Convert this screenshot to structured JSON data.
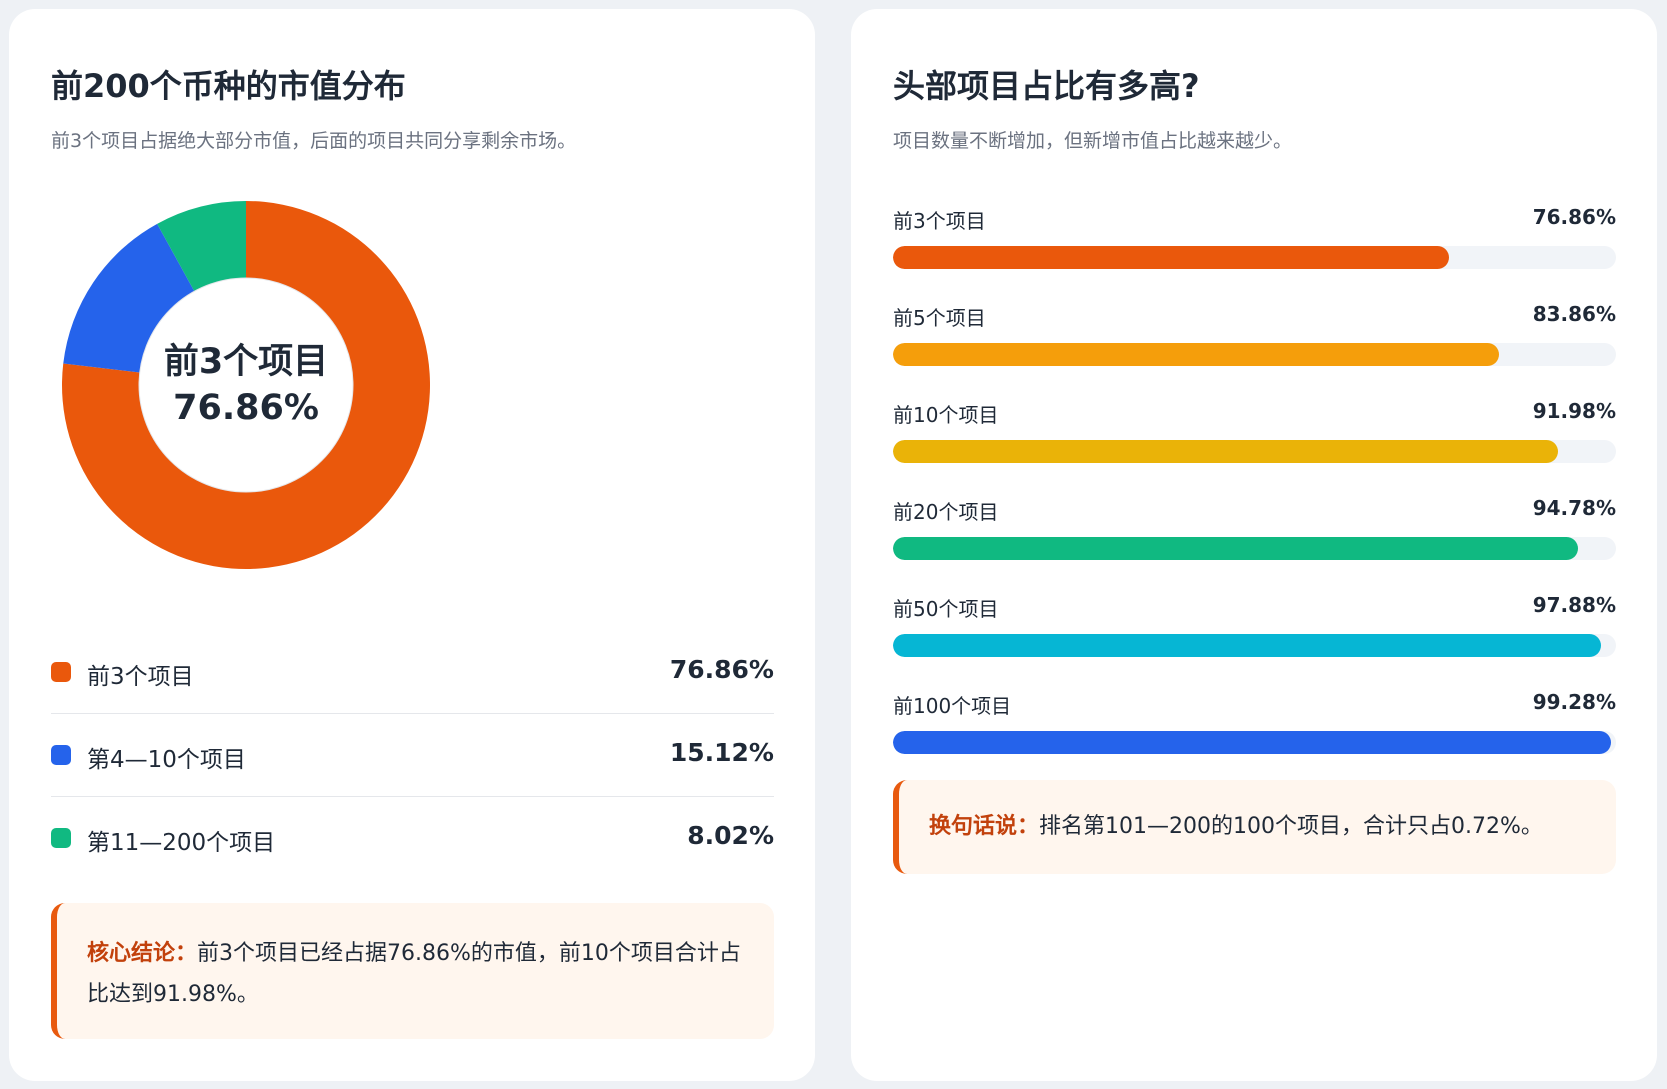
{
  "left": {
    "title": "前200个币种的市值分布",
    "subtitle": "前3个项目占据绝大部分市值，后面的项目共同分享剩余市场。",
    "center_line1": "前3个项目",
    "center_line2": "76.86%",
    "note_key": "核心结论：",
    "note_text": "前3个项目已经占据76.86%的市值，前10个项目合计占比达到91.98%。"
  },
  "right": {
    "title": "头部项目占比有多高?",
    "subtitle": "项目数量不断增加，但新增市值占比越来越少。",
    "note_key": "换句话说：",
    "note_text": "排名第101—200的100个项目，合计只占0.72%。"
  },
  "chart_data": [
    {
      "type": "pie",
      "donut": true,
      "categories": [
        "前3个项目",
        "第4—10个项目",
        "第11—200个项目"
      ],
      "values": [
        76.86,
        15.12,
        8.02
      ],
      "value_labels": [
        "76.86%",
        "15.12%",
        "8.02%"
      ],
      "colors": [
        "#ea580c",
        "#2563eb",
        "#10b981"
      ],
      "title": "前200个币种的市值分布",
      "legend": "bottom"
    },
    {
      "type": "bar",
      "orientation": "horizontal",
      "categories": [
        "前3个项目",
        "前5个项目",
        "前10个项目",
        "前20个项目",
        "前50个项目",
        "前100个项目"
      ],
      "values": [
        76.86,
        83.86,
        91.98,
        94.78,
        97.88,
        99.28
      ],
      "value_labels": [
        "76.86%",
        "83.86%",
        "91.98%",
        "94.78%",
        "97.88%",
        "99.28%"
      ],
      "colors": [
        "#ea580c",
        "#f59e0b",
        "#eab308",
        "#10b981",
        "#06b6d4",
        "#2563eb"
      ],
      "xlim": [
        0,
        100
      ],
      "title": "头部项目占比有多高?"
    }
  ]
}
